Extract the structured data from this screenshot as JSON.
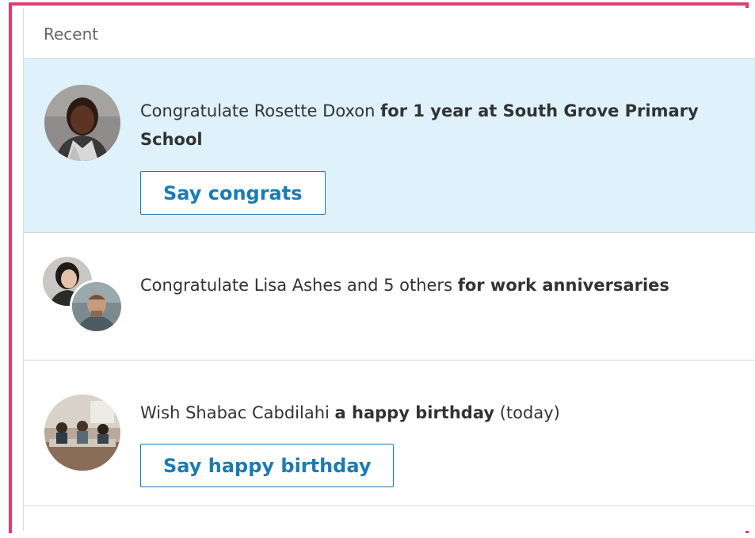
{
  "panel": {
    "title": "Recent"
  },
  "items": [
    {
      "prefix": "Congratulate Rosette Doxon ",
      "bold": "for 1 year at South Grove Primary School",
      "suffix": "",
      "button_label": "Say congrats"
    },
    {
      "prefix": "Congratulate Lisa Ashes and 5 others ",
      "bold": "for work anniversaries",
      "suffix": ""
    },
    {
      "prefix": "Wish Shabac Cabdilahi ",
      "bold": "a happy birthday",
      "suffix": " (today)",
      "button_label": "Say happy birthday"
    }
  ],
  "colors": {
    "accent": "#1a7bb5",
    "highlight_bg": "#dff1fb",
    "frame_border": "#e23a6f"
  }
}
